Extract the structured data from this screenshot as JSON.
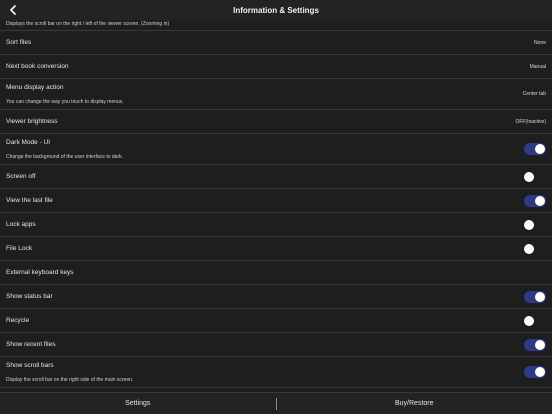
{
  "header": {
    "title": "Information & Settings",
    "back_icon": "chevron-left-icon"
  },
  "top_desc": "Displays the scroll bar on the right / left of the viewer screen. (Zooming in)",
  "rows": [
    {
      "label": "Sort files",
      "value": "None"
    },
    {
      "label": "Next book conversion",
      "value": "Manual"
    },
    {
      "label": "Menu display action",
      "desc": "You can change the way you touch to display menus.",
      "value": "Center tab"
    },
    {
      "label": "Viewer brightness",
      "value": "OFF(Inactive)"
    },
    {
      "label": "Dark Mode - UI",
      "desc": "Change the background of the user interface to dark.",
      "toggle": true
    },
    {
      "label": "Screen off",
      "toggle": false
    },
    {
      "label": "View the last file",
      "toggle": true
    },
    {
      "label": "Lock apps",
      "toggle": false
    },
    {
      "label": "File Lock",
      "toggle": false
    },
    {
      "label": "External keyboard keys"
    },
    {
      "label": "Show status bar",
      "toggle": true
    },
    {
      "label": "Recycle",
      "toggle": false
    },
    {
      "label": "Show recent files",
      "toggle": true
    },
    {
      "label": "Show scroll bars",
      "desc": "Display the scroll bar on the right side of the main screen.",
      "toggle": true
    }
  ],
  "footer": {
    "settings": "Settings",
    "buy_restore": "Buy/Restore"
  },
  "colors": {
    "toggle_on": "#2f3a86",
    "background": "#1e1e1e"
  }
}
